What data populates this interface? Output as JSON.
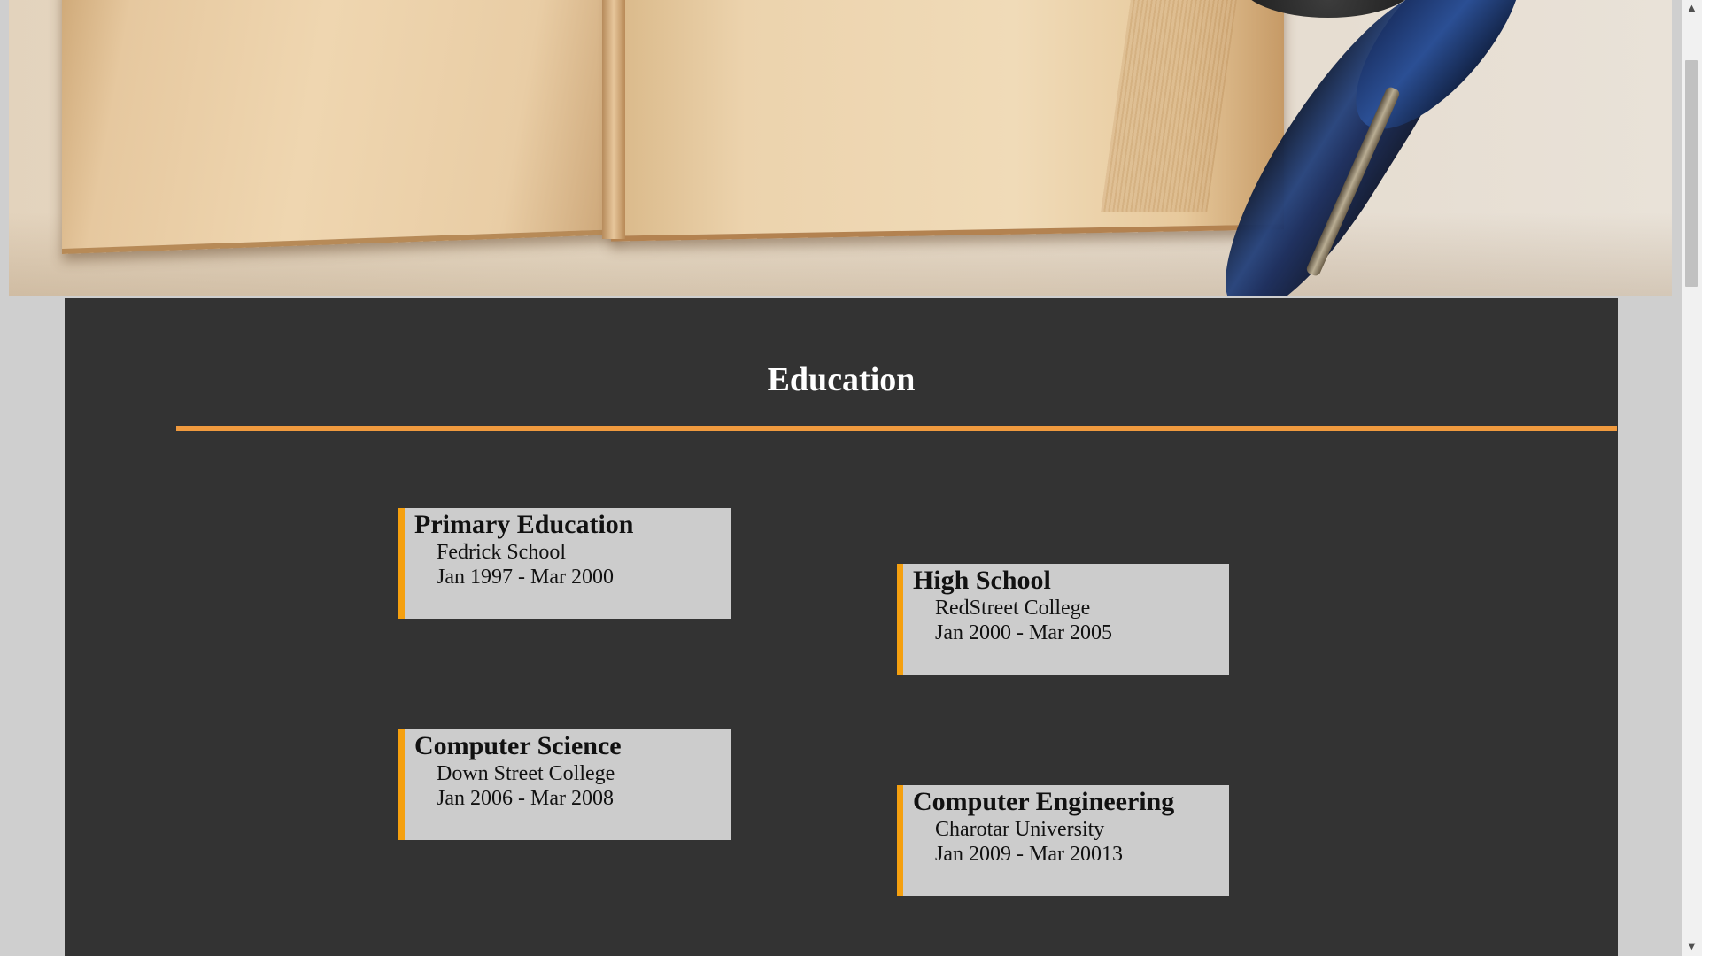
{
  "section": {
    "title": "Education"
  },
  "education": [
    {
      "title": "Primary Education",
      "institution": "Fedrick School",
      "period": "Jan 1997 - Mar 2000"
    },
    {
      "title": "High School",
      "institution": "RedStreet College",
      "period": "Jan 2000 - Mar 2005"
    },
    {
      "title": "Computer Science",
      "institution": "Down Street College",
      "period": "Jan 2006 - Mar 2008"
    },
    {
      "title": "Computer Engineering",
      "institution": "Charotar University",
      "period": "Jan 2009 - Mar 20013"
    }
  ],
  "colors": {
    "section_background": "#333333",
    "accent_rule": "#f09a3e",
    "card_border": "#f5a00f",
    "card_background": "#cccccc",
    "page_background": "#cfcfcf"
  },
  "icons": {
    "scroll_up": "▲",
    "scroll_down": "▼"
  }
}
